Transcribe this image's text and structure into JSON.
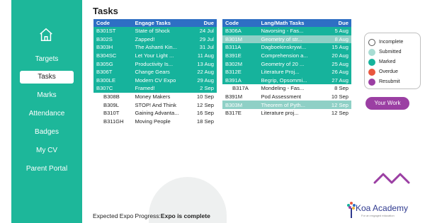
{
  "nav": {
    "items": [
      {
        "label": "Targets"
      },
      {
        "label": "Tasks"
      },
      {
        "label": "Marks"
      },
      {
        "label": "Attendance"
      },
      {
        "label": "Badges"
      },
      {
        "label": "My CV"
      },
      {
        "label": "Parent Portal"
      }
    ]
  },
  "page": {
    "title": "Tasks"
  },
  "engage": {
    "headers": {
      "code": "Code",
      "name": "Engage Tasks",
      "due": "Due"
    },
    "rows": [
      {
        "code": "B301ST",
        "name": "State of Shock",
        "due": "24 Jul"
      },
      {
        "code": "B302S",
        "name": "Zapped!",
        "due": "29 Jul"
      },
      {
        "code": "B303H",
        "name": "The Ashanti Kin...",
        "due": "31 Jul"
      },
      {
        "code": "B304SC",
        "name": "Let Your Light ...",
        "due": "11 Aug"
      },
      {
        "code": "B305G",
        "name": "Productivity Is...",
        "due": "13 Aug"
      },
      {
        "code": "B306T",
        "name": "Change Gears",
        "due": "22 Aug"
      },
      {
        "code": "B300LE",
        "name": "Modern CV Expo",
        "due": "29 Aug"
      },
      {
        "code": "B307C",
        "name": "Framed!",
        "due": "2 Sep"
      },
      {
        "code": "B308B",
        "name": "Money Makers",
        "due": "10 Sep"
      },
      {
        "code": "B309L",
        "name": "STOP! And Think",
        "due": "12 Sep"
      },
      {
        "code": "B310T",
        "name": "Gaining Advanta...",
        "due": "16 Sep"
      },
      {
        "code": "B311GH",
        "name": "Moving People",
        "due": "18 Sep"
      }
    ]
  },
  "langmath": {
    "headers": {
      "code": "Code",
      "name": "Lang/Math Tasks",
      "due": "Due"
    },
    "rows": [
      {
        "code": "B306A",
        "name": "Navorsing - Fas...",
        "due": "5 Aug"
      },
      {
        "code": "B301M",
        "name": "Geometry of str...",
        "due": "8 Aug"
      },
      {
        "code": "B311A",
        "name": "Dagboekinskrywi...",
        "due": "15 Aug"
      },
      {
        "code": "B391E",
        "name": "Comprehension a...",
        "due": "20 Aug"
      },
      {
        "code": "B302M",
        "name": "Geometry of 20 ...",
        "due": "25 Aug"
      },
      {
        "code": "B312E",
        "name": "Literature Proj...",
        "due": "26 Aug"
      },
      {
        "code": "B391A",
        "name": "Begrip, Opsommi...",
        "due": "27 Aug"
      },
      {
        "code": "B317A",
        "name": "Mondeling - Fas...",
        "due": "8 Sep"
      },
      {
        "code": "B391M",
        "name": "Pod Assessment",
        "due": "10 Sep"
      },
      {
        "code": "B303M",
        "name": "Theorem of Pyth...",
        "due": "12 Sep"
      },
      {
        "code": "B317E",
        "name": "Literature proj...",
        "due": "12 Sep"
      }
    ]
  },
  "legend": {
    "items": [
      {
        "label": "Incomplete",
        "color": "#ffffff"
      },
      {
        "label": "Submitted",
        "color": "#a8dcd3"
      },
      {
        "label": "Marked",
        "color": "#16b39c"
      },
      {
        "label": "Overdue",
        "color": "#e9573f"
      },
      {
        "label": "Resubmit",
        "color": "#9b3fa3"
      }
    ]
  },
  "your_work_label": "Your Work",
  "expo": {
    "prefix": "Expected Expo Progress:",
    "status": "Expo is complete"
  },
  "logo": {
    "name": "Koa Academy",
    "tagline": "For an engaged education"
  },
  "colors": {
    "accent": "#1db79a",
    "header": "#2e6fc4",
    "marked": "#16b39c",
    "submitted": "#8fd0c6",
    "button": "#9b3fa3"
  }
}
